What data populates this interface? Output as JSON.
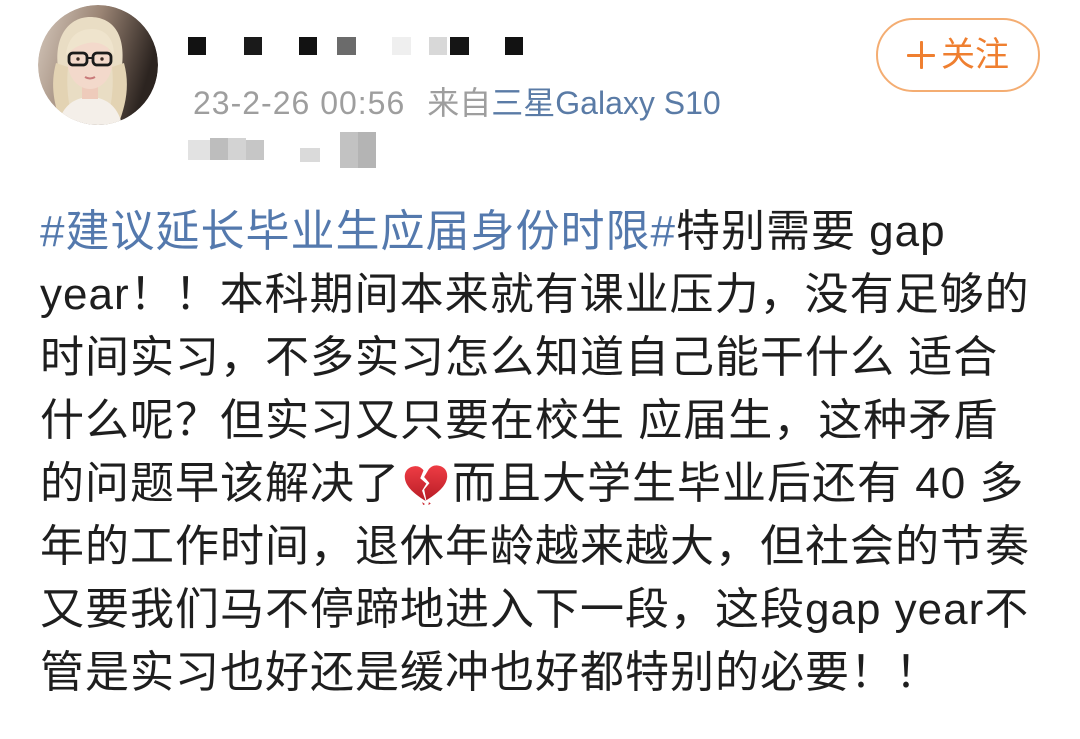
{
  "user": {
    "timestamp": "23-2-26 00:56",
    "source_prefix": "来自",
    "source_device": "三星Galaxy S10"
  },
  "follow_button": {
    "icon": "plus-icon",
    "label": "关注"
  },
  "post": {
    "lines": [
      [
        {
          "hashtag": "#建议延长毕业生应届身份时限#"
        },
        {
          "text": "特别需要 gap"
        }
      ],
      [
        {
          "text": "year！！本科期间本来就有课业压力，没有足够的"
        }
      ],
      [
        {
          "text": "时间实习，不多实习怎么知道自己能干什么 适合"
        }
      ],
      [
        {
          "text": "什么呢？但实习又只要在校生 应届生，这种矛盾"
        }
      ],
      [
        {
          "text": "的问题早该解决了"
        },
        {
          "emoji": "broken-heart-icon"
        },
        {
          "text": "而且大学生毕业后还有 40 多"
        }
      ],
      [
        {
          "text": "年的工作时间，退休年龄越来越大，但社会的节奏"
        }
      ],
      [
        {
          "text": "又要我们马不停蹄地进入下一段，这段gap year不"
        }
      ],
      [
        {
          "text": "管是实习也好还是缓冲也好都特别的必要！！"
        }
      ]
    ]
  },
  "colors": {
    "background": "#ffffff",
    "text": "#1e1e1e",
    "hashtag": "#5479ad",
    "meta": "#9e9e9e",
    "source_link": "#5a7ba6",
    "follow_accent": "#ef7f30",
    "follow_border": "#f4ad72"
  }
}
